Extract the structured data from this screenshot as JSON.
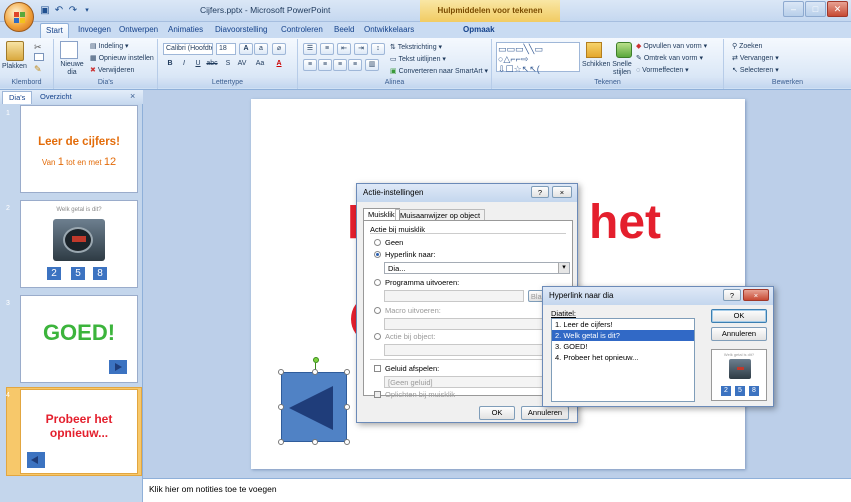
{
  "window": {
    "title": "Cijfers.pptx - Microsoft PowerPoint",
    "contextual_tab_group": "Hulpmiddelen voor tekenen"
  },
  "tabs": [
    "Start",
    "Invoegen",
    "Ontwerpen",
    "Animaties",
    "Diavoorstelling",
    "Controleren",
    "Beeld",
    "Ontwikkelaars",
    "Opmaak"
  ],
  "ribbon": {
    "clipboard": {
      "paste": "Plakken",
      "label": "Klembord"
    },
    "slides": {
      "new_slide": "Nieuwe dia",
      "layout": "Indeling",
      "reset": "Opnieuw instellen",
      "delete": "Verwijderen",
      "label": "Dia's"
    },
    "font": {
      "name": "Calibri (Hoofdtek",
      "size": "18",
      "label": "Lettertype"
    },
    "paragraph": {
      "text_direction": "Tekstrichting",
      "align_text": "Tekst uitlijnen",
      "smartart": "Converteren naar SmartArt",
      "label": "Alinea"
    },
    "drawing": {
      "arrange": "Schikken",
      "quick_styles": "Snelle stijlen",
      "fill": "Opvullen van vorm",
      "outline": "Omtrek van vorm",
      "effects": "Vormeffecten",
      "label": "Tekenen"
    },
    "editing": {
      "find": "Zoeken",
      "replace": "Vervangen",
      "select": "Selecteren",
      "label": "Bewerken"
    }
  },
  "pane": {
    "tabs": [
      "Dia's",
      "Overzicht"
    ],
    "close": "×",
    "slides": [
      {
        "num": "1",
        "title": "Leer de cijfers!",
        "sub_pre": "Van ",
        "sub_a": "1",
        "sub_mid": " tot en met ",
        "sub_b": "12"
      },
      {
        "num": "2",
        "question": "Welk getal is dit?",
        "choices": [
          "2",
          "5",
          "8"
        ]
      },
      {
        "num": "3",
        "title": "GOED!"
      },
      {
        "num": "4",
        "title": "Probeer het opnieuw..."
      }
    ]
  },
  "slide": {
    "text_left": "P",
    "text_right": "het"
  },
  "action_dialog": {
    "title": "Actie-instellingen",
    "help": "?",
    "close": "×",
    "tabs": [
      "Muisklik",
      "Muisaanwijzer op object"
    ],
    "section": "Actie bij muisklik",
    "opt_none": "Geen",
    "opt_hyperlink": "Hyperlink naar:",
    "hyperlink_value": "Dia...",
    "opt_program": "Programma uitvoeren:",
    "browse": "Bladeren...",
    "opt_macro": "Macro uitvoeren:",
    "opt_object": "Actie bij object:",
    "sound": "Geluid afspelen:",
    "sound_value": "[Geen geluid]",
    "highlight": "Oplichten bij muisklik",
    "ok": "OK",
    "cancel": "Annuleren"
  },
  "hyperlink_dialog": {
    "title": "Hyperlink naar dia",
    "help": "?",
    "close": "×",
    "list_label": "Diatitel:",
    "items": [
      "1. Leer de cijfers!",
      "2. Welk getal is dit?",
      "3. GOED!",
      "4. Probeer het opnieuw..."
    ],
    "selected_index": 1,
    "ok": "OK",
    "cancel": "Annuleren",
    "preview_caption": "Welk getal is dit?",
    "preview_choices": [
      "2",
      "5",
      "8"
    ]
  },
  "notes_placeholder": "Klik hier om notities toe te voegen",
  "colors": {
    "accent_orange": "#e36c0a",
    "red": "#e41f2d",
    "green": "#3cb43c",
    "blue_box": "#3c73c1",
    "selection": "#3169c6"
  }
}
